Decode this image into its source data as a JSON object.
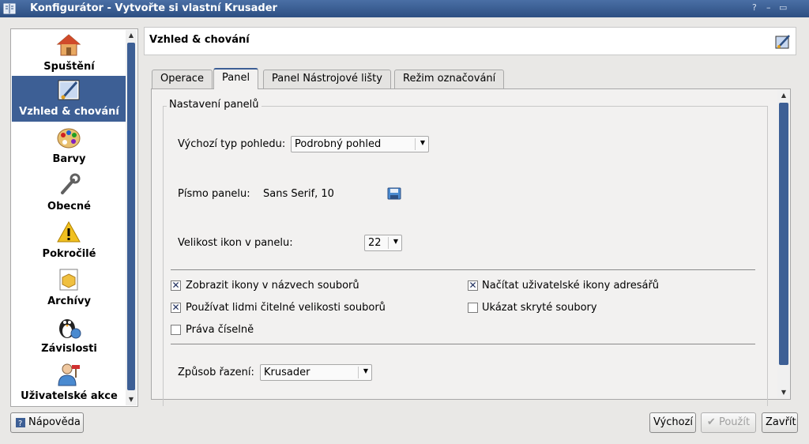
{
  "window": {
    "title": "Konfigurátor - Vytvořte si vlastní Krusader",
    "controls": [
      "?",
      "–",
      "▭"
    ]
  },
  "sidebar": {
    "items": [
      {
        "label": "Spuštění",
        "icon": "home-icon"
      },
      {
        "label": "Vzhled & chování",
        "icon": "paint-brush-icon",
        "active": true
      },
      {
        "label": "Barvy",
        "icon": "palette-icon"
      },
      {
        "label": "Obecné",
        "icon": "wrench-icon"
      },
      {
        "label": "Pokročilé",
        "icon": "warning-icon"
      },
      {
        "label": "Archívy",
        "icon": "archive-icon"
      },
      {
        "label": "Závislosti",
        "icon": "penguin-icon"
      },
      {
        "label": "Uživatelské akce",
        "icon": "user-actions-icon"
      }
    ]
  },
  "header": {
    "title": "Vzhled & chování"
  },
  "tabs": [
    {
      "label": "Operace"
    },
    {
      "label": "Panel",
      "active": true
    },
    {
      "label": "Panel Nástrojové lišty"
    },
    {
      "label": "Režim označování"
    }
  ],
  "panel_settings": {
    "group_title": "Nastavení panelů",
    "view_type": {
      "label": "Výchozí typ pohledu:",
      "value": "Podrobný pohled"
    },
    "font": {
      "label": "Písmo panelu:",
      "value": "Sans Serif, 10"
    },
    "icon_size": {
      "label": "Velikost ikon v panelu:",
      "value": "22"
    },
    "checkboxes": [
      {
        "label": "Zobrazit ikony v názvech souborů",
        "checked": true
      },
      {
        "label": "Načítat uživatelské ikony adresářů",
        "checked": true
      },
      {
        "label": "Používat lidmi čitelné velikosti souborů",
        "checked": true
      },
      {
        "label": "Ukázat skryté soubory",
        "checked": false
      },
      {
        "label": "Práva číselně",
        "checked": false
      }
    ],
    "sort": {
      "label": "Způsob řazení:",
      "value": "Krusader"
    }
  },
  "buttons": {
    "help": "Nápověda",
    "defaults": "Výchozí",
    "apply": "Použít",
    "close": "Zavřít"
  },
  "colors": {
    "accent": "#3d5f95",
    "titlebar": "#2d4f82"
  }
}
